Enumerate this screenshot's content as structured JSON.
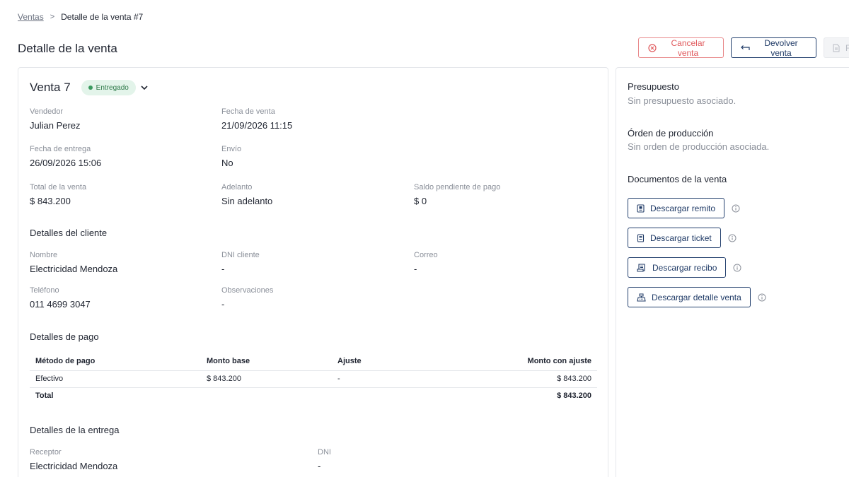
{
  "breadcrumb": {
    "parent": "Ventas",
    "separator": ">",
    "current": "Detalle de la venta #7"
  },
  "page_title": "Detalle de la venta",
  "actions": {
    "cancel_label": "Cancelar venta",
    "return_label": "Devolver venta",
    "disabled_label": "F"
  },
  "sale": {
    "title": "Venta 7",
    "status": "Entregado",
    "fields": {
      "seller_label": "Vendedor",
      "seller": "Julian Perez",
      "sale_date_label": "Fecha de venta",
      "sale_date": "21/09/2026 11:15",
      "delivery_date_label": "Fecha de entrega",
      "delivery_date": "26/09/2026 15:06",
      "shipping_label": "Envío",
      "shipping": "No",
      "total_label": "Total de la venta",
      "total": "$ 843.200",
      "advance_label": "Adelanto",
      "advance": "Sin adelanto",
      "balance_label": "Saldo pendiente de pago",
      "balance": "$ 0"
    }
  },
  "client": {
    "section_title": "Detalles del cliente",
    "name_label": "Nombre",
    "name": "Electricidad Mendoza",
    "dni_label": "DNI cliente",
    "dni": "-",
    "email_label": "Correo",
    "email": "-",
    "phone_label": "Teléfono",
    "phone": "011 4699 3047",
    "notes_label": "Observaciones",
    "notes": "-"
  },
  "payment": {
    "section_title": "Detalles de pago",
    "headers": [
      "Método de pago",
      "Monto base",
      "Ajuste",
      "Monto con ajuste"
    ],
    "rows": [
      [
        "Efectivo",
        "$ 843.200",
        "-",
        "$ 843.200"
      ]
    ],
    "total_label": "Total",
    "total_value": "$ 843.200"
  },
  "delivery": {
    "section_title": "Detalles de la entrega",
    "receiver_label": "Receptor",
    "receiver": "Electricidad Mendoza",
    "dni_label": "DNI",
    "dni": "-"
  },
  "side": {
    "budget_title": "Presupuesto",
    "budget_text": "Sin presupuesto asociado.",
    "production_title": "Órden de producción",
    "production_text": "Sin orden de producción asociada.",
    "docs_title": "Documentos de la venta",
    "docs": [
      {
        "label": "Descargar remito",
        "icon": "receipt-icon"
      },
      {
        "label": "Descargar ticket",
        "icon": "ticket-icon"
      },
      {
        "label": "Descargar recibo",
        "icon": "invoice-icon"
      },
      {
        "label": "Descargar detalle venta",
        "icon": "cash-register-icon"
      }
    ]
  },
  "colors": {
    "primary": "#1f3a66",
    "danger": "#e05a5d",
    "status_bg": "#e3f4ea",
    "status_text": "#2f7a4a"
  }
}
